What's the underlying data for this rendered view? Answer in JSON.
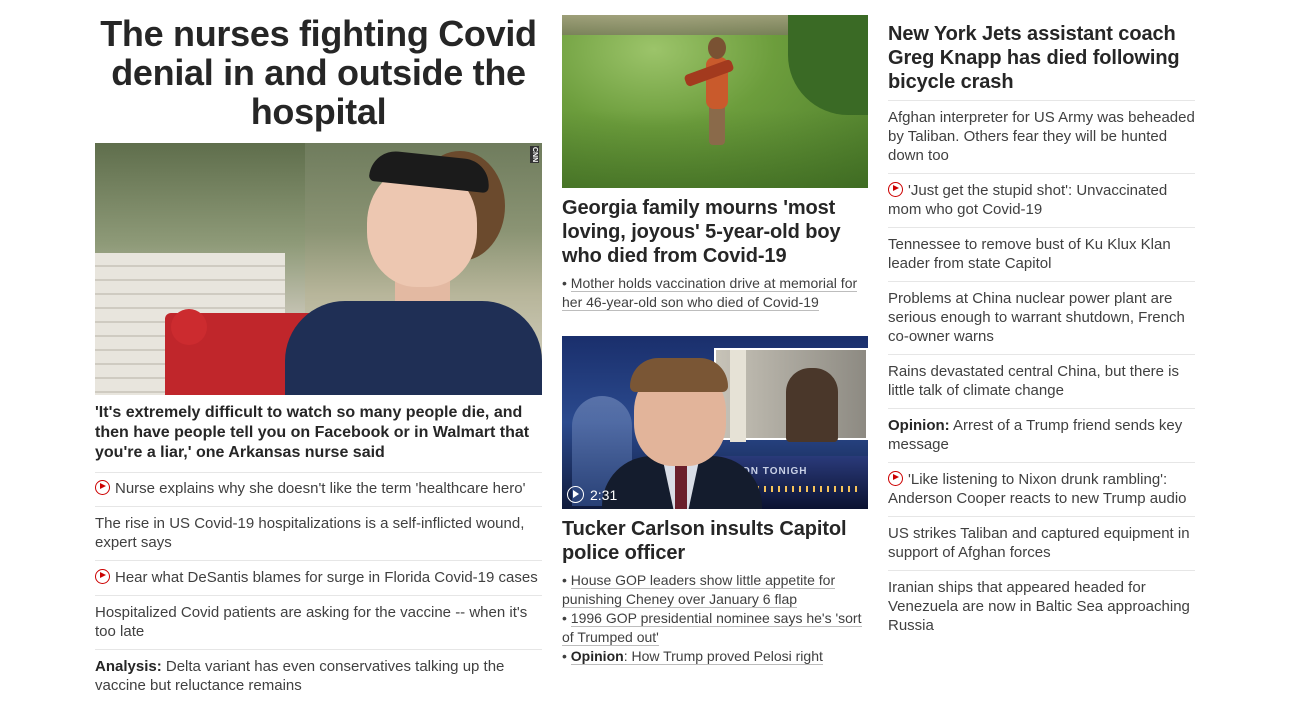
{
  "left": {
    "headline": "The nurses fighting Covid denial in and outside the hospital",
    "image_mark": "CNN",
    "subheadline": "'It's extremely difficult to watch so many people die, and then have people tell you on Facebook or in Walmart that you're a liar,' one Arkansas nurse said",
    "items": [
      {
        "video": true,
        "label": "",
        "text": "Nurse explains why she doesn't like the term 'healthcare hero'"
      },
      {
        "video": false,
        "label": "",
        "text": "The rise in US Covid-19 hospitalizations is a self-inflicted wound, expert says"
      },
      {
        "video": true,
        "label": "",
        "text": "Hear what DeSantis blames for surge in Florida Covid-19 cases"
      },
      {
        "video": false,
        "label": "",
        "text": "Hospitalized Covid patients are asking for the vaccine -- when it's too late"
      },
      {
        "video": false,
        "label": "Analysis:",
        "text": "Delta variant has even conservatives talking up the vaccine but reluctance remains"
      }
    ]
  },
  "middle": {
    "story1": {
      "headline": "Georgia family mourns 'most loving, joyous' 5-year-old boy who died from Covid-19",
      "bullet": "Mother holds vaccination drive at memorial for her 46-year-old son who died of Covid-19"
    },
    "story2": {
      "duration": "2:31",
      "image_text": "ON TONIGH",
      "headline": "Tucker Carlson insults Capitol police officer",
      "bullets": [
        {
          "label": "",
          "text": "House GOP leaders show little appetite for punishing Cheney over January 6 flap"
        },
        {
          "label": "",
          "text": "1996 GOP presidential nominee says he's 'sort of Trumped out'"
        },
        {
          "label": "Opinion",
          "text": ": How Trump proved Pelosi right"
        }
      ]
    }
  },
  "right": {
    "headline": "New York Jets assistant coach Greg Knapp has died following bicycle crash",
    "items": [
      {
        "video": false,
        "label": "",
        "text": "Afghan interpreter for US Army was beheaded by Taliban. Others fear they will be hunted down too"
      },
      {
        "video": true,
        "label": "",
        "text": "'Just get the stupid shot': Unvaccinated mom who got Covid-19"
      },
      {
        "video": false,
        "label": "",
        "text": "Tennessee to remove bust of Ku Klux Klan leader from state Capitol"
      },
      {
        "video": false,
        "label": "",
        "text": "Problems at China nuclear power plant are serious enough to warrant shutdown, French co-owner warns"
      },
      {
        "video": false,
        "label": "",
        "text": "Rains devastated central China, but there is little talk of climate change"
      },
      {
        "video": false,
        "label": "Opinion:",
        "text": "Arrest of a Trump friend sends key message"
      },
      {
        "video": true,
        "label": "",
        "text": "'Like listening to Nixon drunk rambling': Anderson Cooper reacts to new Trump audio"
      },
      {
        "video": false,
        "label": "",
        "text": "US strikes Taliban and captured equipment in support of Afghan forces"
      },
      {
        "video": false,
        "label": "",
        "text": "Iranian ships that appeared headed for Venezuela are now in Baltic Sea approaching Russia"
      }
    ]
  },
  "colors": {
    "text": "#262626",
    "secondary_text": "#404040",
    "video_icon": "#cc0000",
    "divider": "#e6e6e6"
  },
  "icons": {
    "video": "play-circle-icon"
  }
}
